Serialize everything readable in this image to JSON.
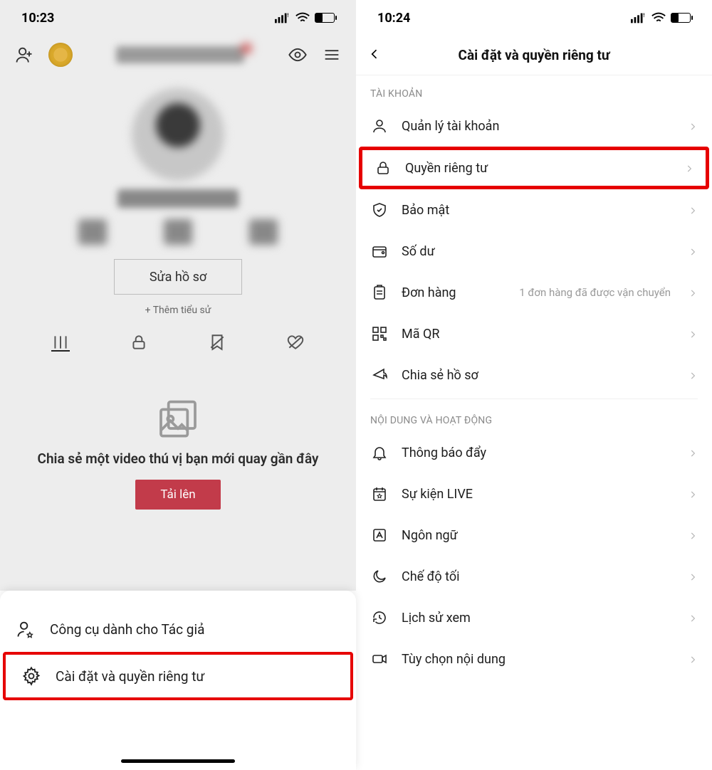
{
  "left": {
    "status_time": "10:23",
    "edit_profile": "Sửa hồ sơ",
    "add_bio": "+ Thêm tiểu sử",
    "empty_title": "Chia sẻ một video thú vị bạn mới quay gần đây",
    "upload": "Tải lên",
    "sheet": {
      "creator_tools": "Công cụ dành cho Tác giả",
      "settings_privacy": "Cài đặt và quyền riêng tư"
    }
  },
  "right": {
    "status_time": "10:24",
    "header": "Cài đặt và quyền riêng tư",
    "section1": "TÀI KHOẢN",
    "items1": {
      "manage_account": "Quản lý tài khoản",
      "privacy": "Quyền riêng tư",
      "security": "Bảo mật",
      "balance": "Số dư",
      "orders": "Đơn hàng",
      "orders_extra": "1 đơn hàng đã được vận chuyển",
      "qr": "Mã QR",
      "share_profile": "Chia sẻ hồ sơ"
    },
    "section2": "NỘI DUNG VÀ HOẠT ĐỘNG",
    "items2": {
      "push": "Thông báo đẩy",
      "live_events": "Sự kiện LIVE",
      "language": "Ngôn ngữ",
      "dark_mode": "Chế độ tối",
      "watch_history": "Lịch sử xem",
      "content_pref": "Tùy chọn nội dung"
    }
  }
}
